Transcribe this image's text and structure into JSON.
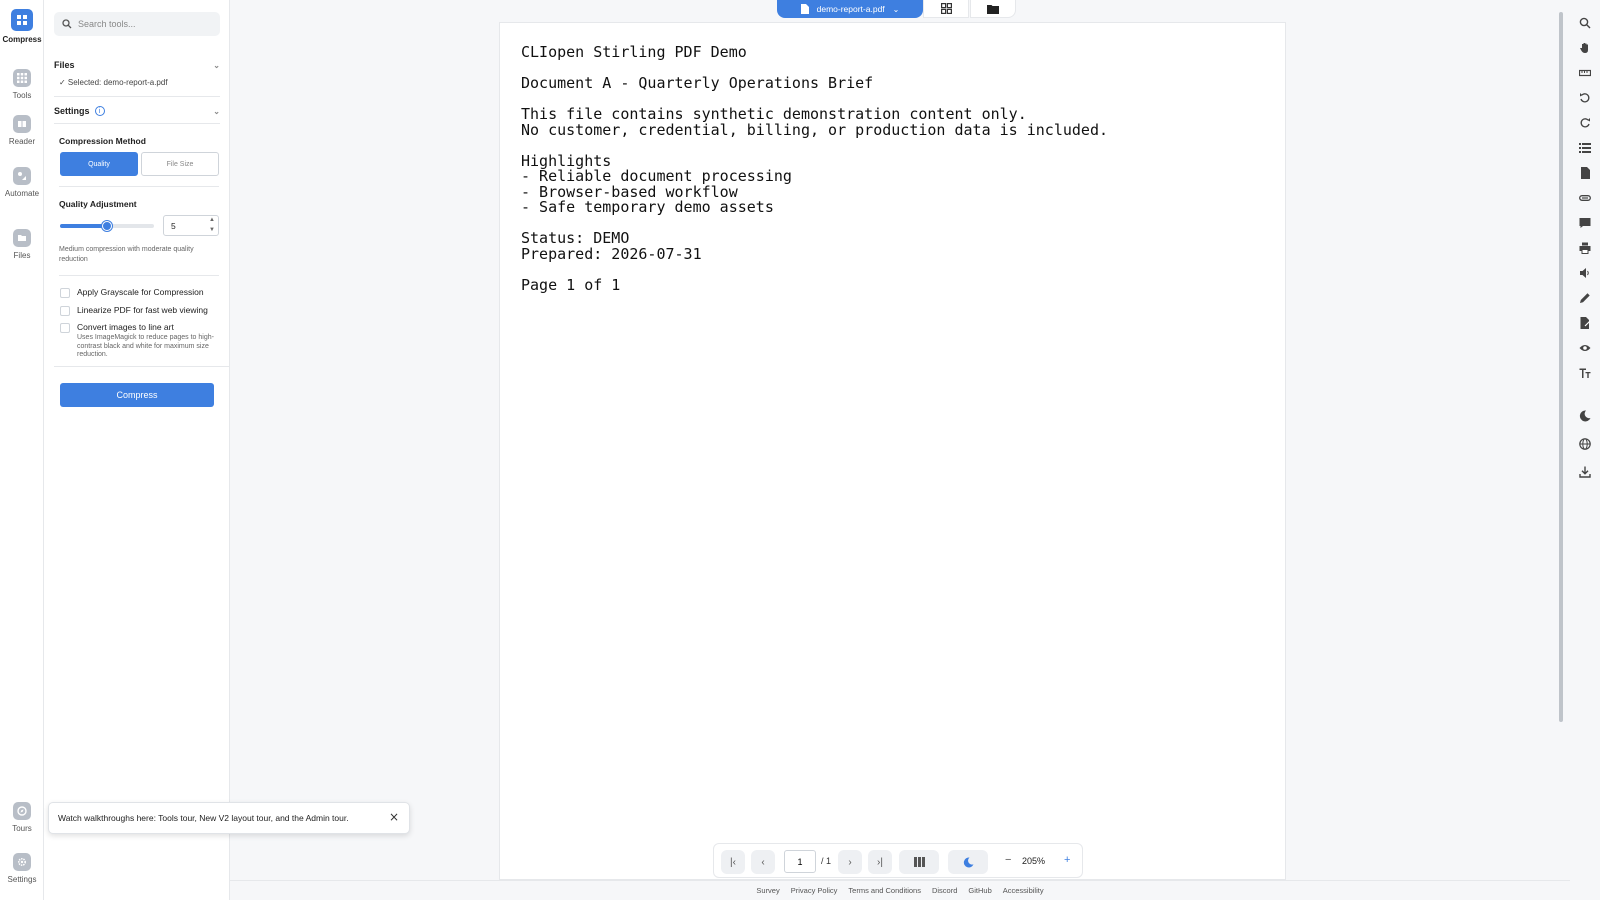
{
  "rail": {
    "top": [
      {
        "label": "Compress",
        "icon": "compress-icon"
      },
      {
        "label": "Tools",
        "icon": "grid-icon"
      },
      {
        "label": "Reader",
        "icon": "book-icon"
      },
      {
        "label": "Automate",
        "icon": "automate-icon"
      },
      {
        "label": "Files",
        "icon": "folder-icon"
      }
    ],
    "bottom": [
      {
        "label": "Tours",
        "icon": "compass-icon"
      },
      {
        "label": "Settings",
        "icon": "gear-icon"
      }
    ]
  },
  "panel": {
    "search_placeholder": "Search tools...",
    "files_header": "Files",
    "selected_file": "✓ Selected: demo-report-a.pdf",
    "settings_header": "Settings",
    "compression_method_label": "Compression Method",
    "method_quality": "Quality",
    "method_filesize": "File Size",
    "quality_adjustment_label": "Quality Adjustment",
    "quality_value": "5",
    "quality_fraction": 0.5,
    "quality_help": "Medium compression with moderate quality reduction",
    "option_grayscale": "Apply Grayscale for Compression",
    "option_linearize": "Linearize PDF for fast web viewing",
    "option_lineart": "Convert images to line art",
    "option_lineart_desc": "Uses ImageMagick to reduce pages to high-contrast black and white for maximum size reduction.",
    "compress_button": "Compress"
  },
  "topbar": {
    "file_tab": "demo-report-a.pdf"
  },
  "document": {
    "lines": [
      "CLIopen Stirling PDF Demo",
      "",
      "Document A - Quarterly Operations Brief",
      "",
      "This file contains synthetic demonstration content only.",
      "No customer, credential, billing, or production data is included.",
      "",
      "Highlights",
      "- Reliable document processing",
      "- Browser-based workflow",
      "- Safe temporary demo assets",
      "",
      "Status: DEMO",
      "Prepared: 2026-07-31",
      "",
      "Page 1 of 1"
    ]
  },
  "nav": {
    "page_value": "1",
    "total": "/ 1",
    "zoom": "205%",
    "zoom_minus": "−",
    "zoom_plus": "+"
  },
  "footer": [
    "Survey",
    "Privacy Policy",
    "Terms and Conditions",
    "Discord",
    "GitHub",
    "Accessibility"
  ],
  "toast": {
    "text": "Watch walkthroughs here: Tools tour, New V2 layout tour, and the Admin tour.",
    "close": "×"
  },
  "colors": {
    "accent": "#3e7fe0",
    "rail_icon": "#b8bec7"
  }
}
